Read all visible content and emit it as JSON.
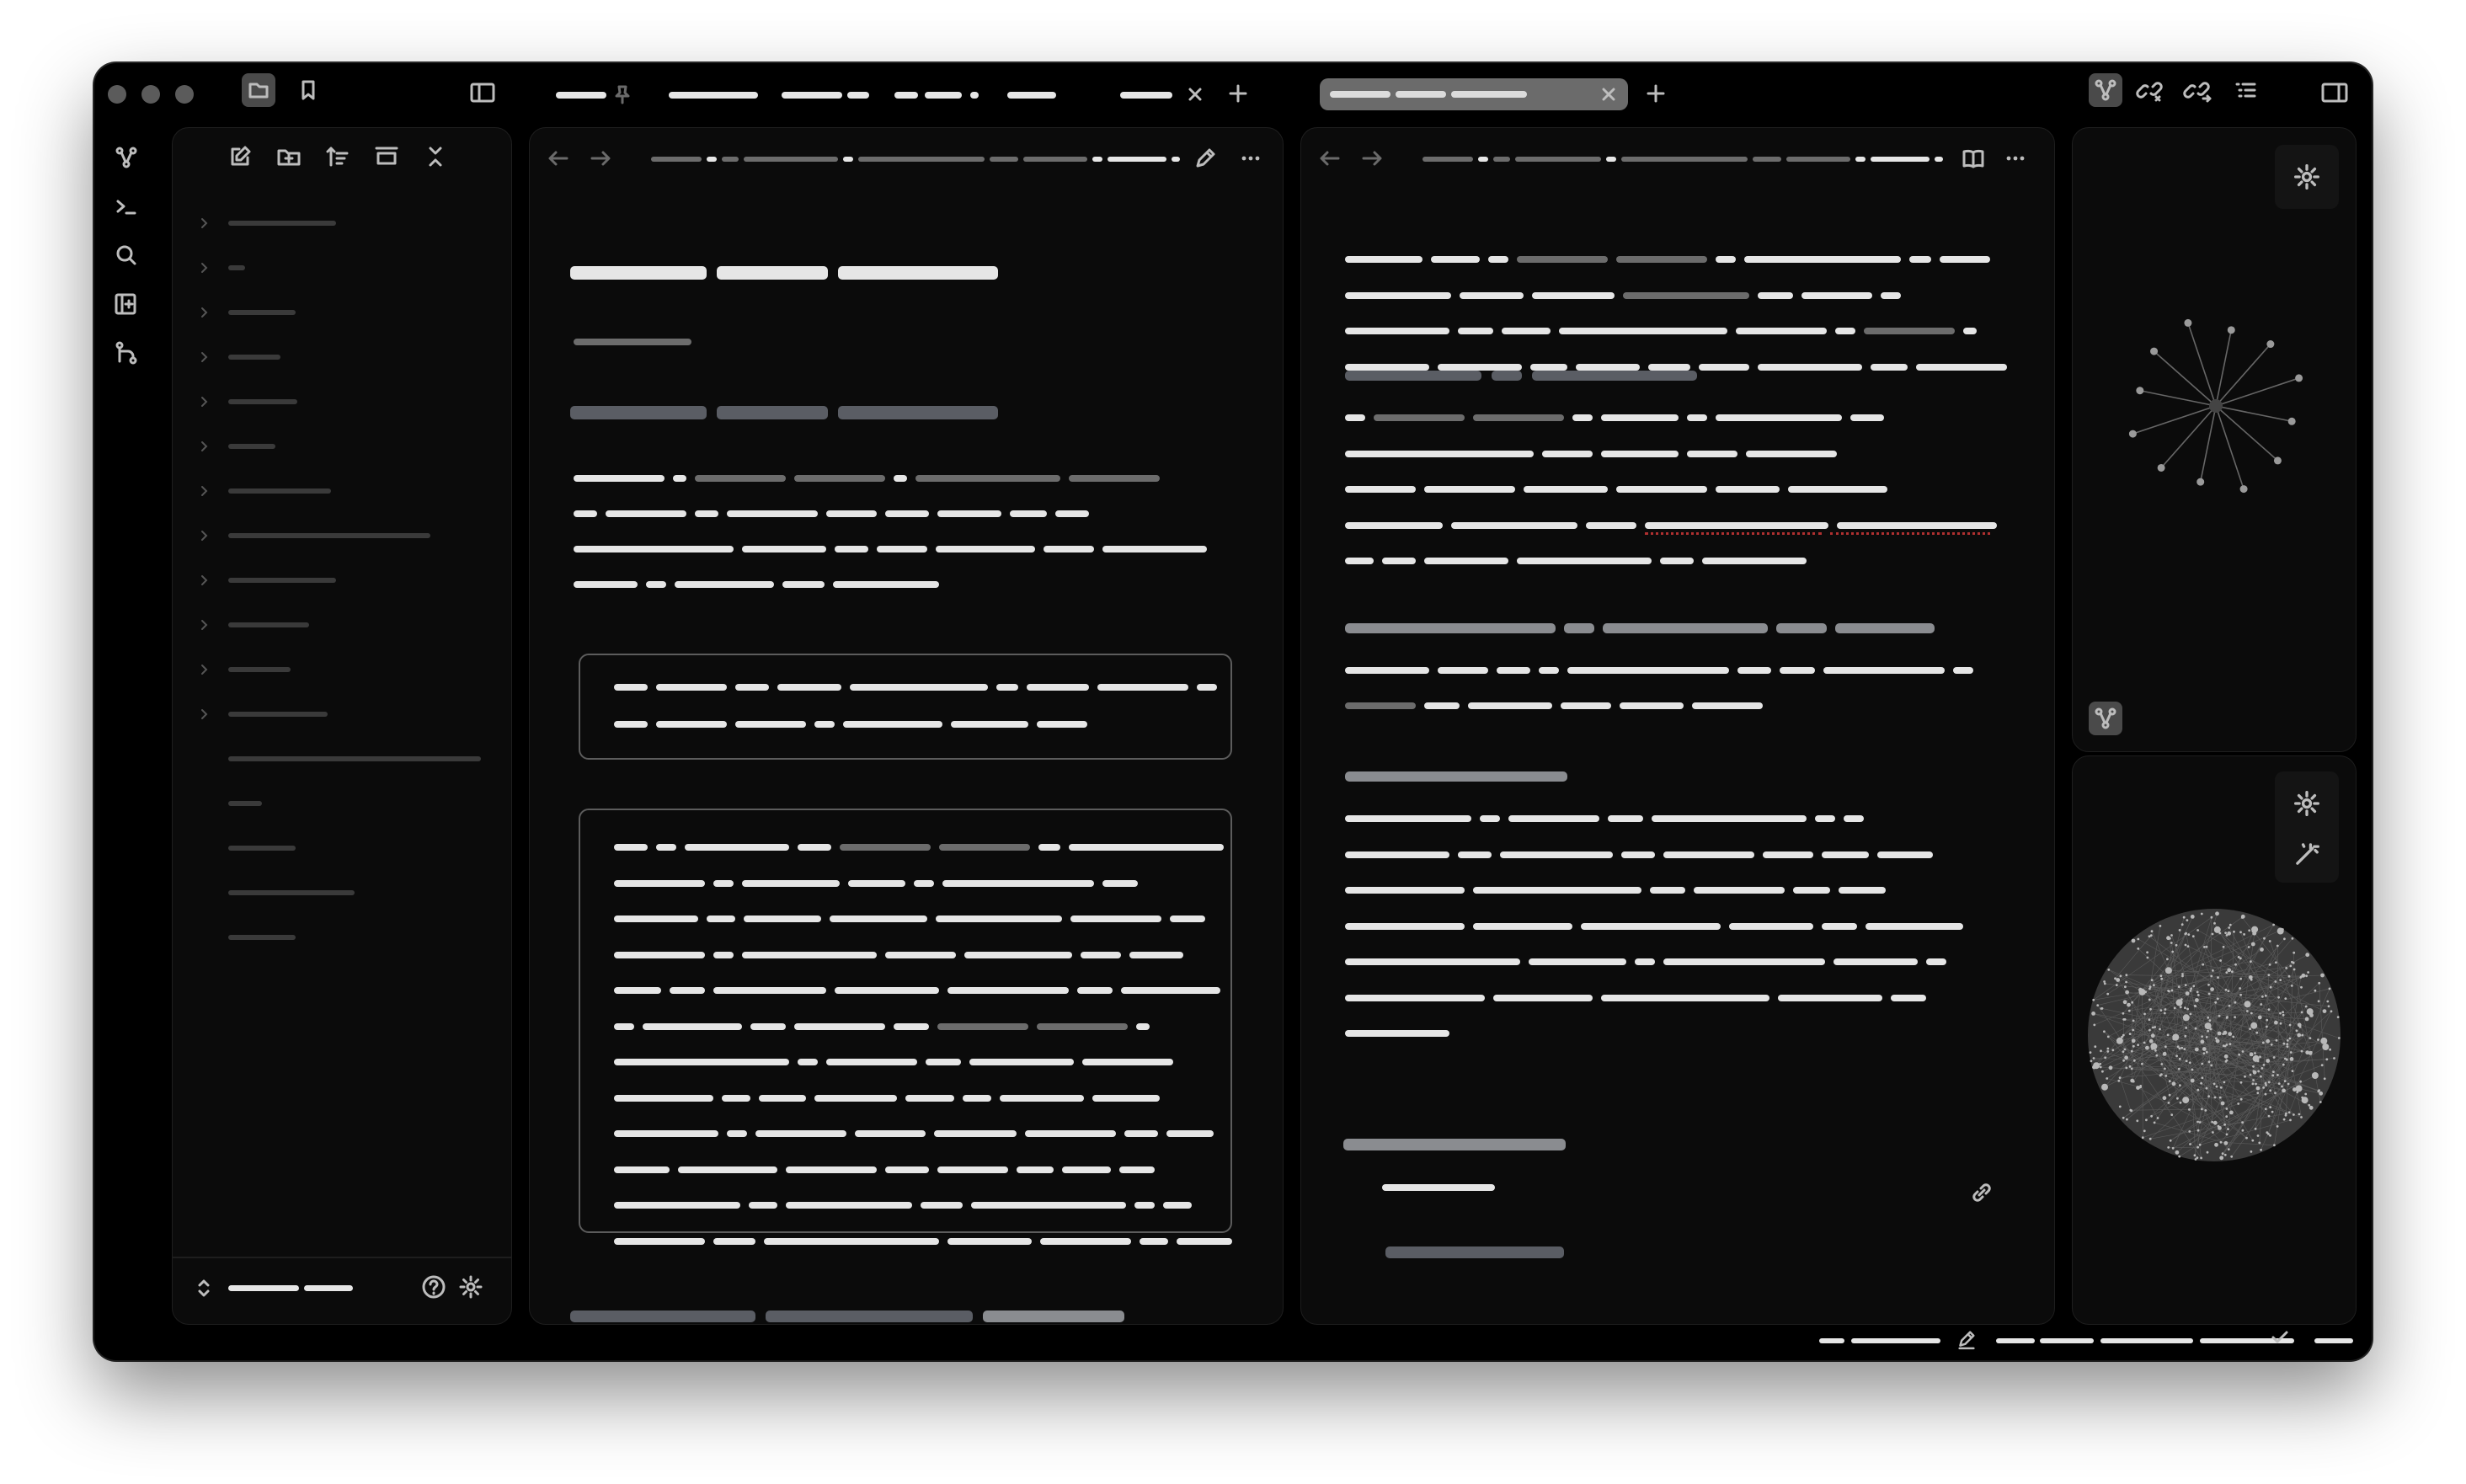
{
  "window": {
    "traffic_lights": [
      "close",
      "minimize",
      "zoom"
    ]
  },
  "toolbar": {
    "left_icons": [
      "files-icon",
      "bookmark-icon"
    ],
    "sidebar_toggle": "sidebar-left-icon",
    "right_icons": [
      "graph-view-icon",
      "backlinks-icon",
      "outgoing-links-icon",
      "outline-icon",
      "sidebar-right-icon"
    ]
  },
  "tabs": [
    {
      "label": "",
      "pinned": true
    },
    {
      "label": ""
    },
    {
      "label": ""
    },
    {
      "label": ""
    },
    {
      "label": ""
    },
    {
      "label": "",
      "closable": true
    }
  ],
  "tab_group_2": {
    "active_tab": "",
    "closable": true
  },
  "ribbon": {
    "icons": [
      "graph-icon",
      "terminal-icon",
      "search-icon",
      "canvas-icon",
      "git-icon"
    ]
  },
  "file_explorer": {
    "actions": [
      "new-note-icon",
      "new-folder-icon",
      "sort-icon",
      "collapse-icon",
      "close-all-icon"
    ],
    "vault_name": "",
    "footer_icons": [
      "help-icon",
      "settings-icon"
    ]
  },
  "editor_left": {
    "nav": [
      "back-icon",
      "forward-icon"
    ],
    "actions": [
      "edit-icon",
      "more-icon"
    ]
  },
  "editor_right": {
    "nav": [
      "back-icon",
      "forward-icon"
    ],
    "actions": [
      "reading-icon",
      "more-icon"
    ]
  },
  "right_sidebar": {
    "local_graph": {
      "settings_icon": "settings-icon",
      "node_count": 12
    },
    "global_graph": {
      "settings_icon": "settings-icon",
      "magic_icon": "wand-icon",
      "label": "graph-view-icon"
    }
  },
  "status_bar": {
    "icons": [
      "edit-mode-icon",
      "sync-check-icon"
    ]
  },
  "colors": {
    "background": "#000000",
    "panel": "#0b0b0b",
    "text_bar": "#e6e6e6",
    "link_bar": "#5a5d64",
    "muted_bar": "#6c6c6c",
    "accent_underline": "#b03030"
  }
}
